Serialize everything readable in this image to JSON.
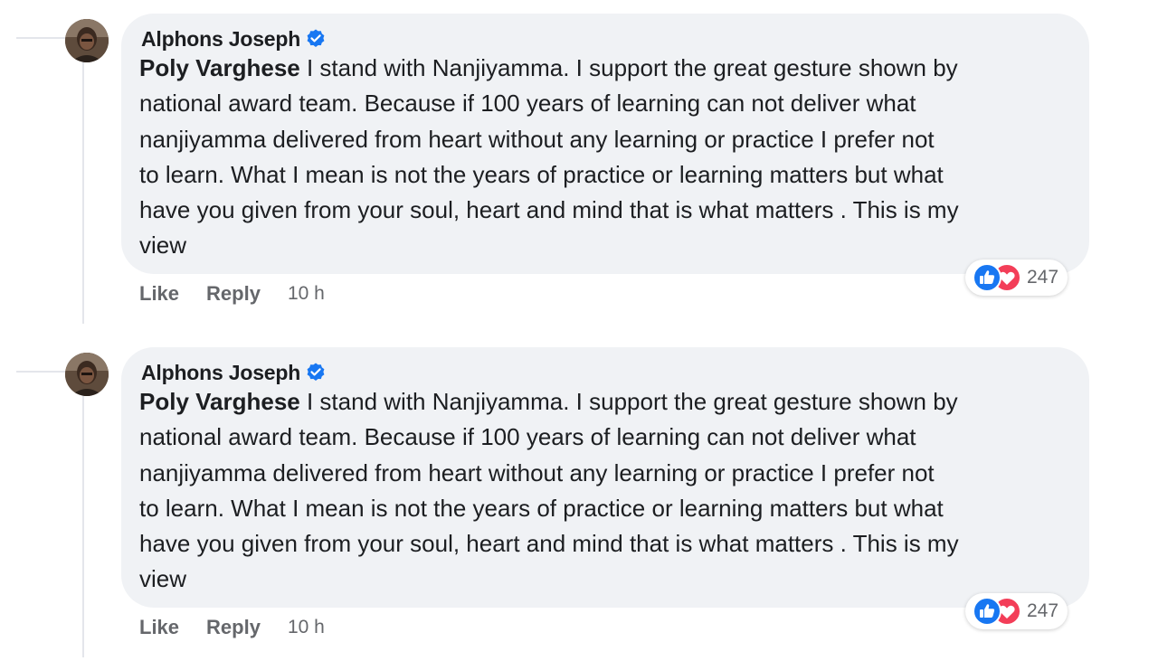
{
  "comments": [
    {
      "author": "Alphons Joseph",
      "mention": "Poly Varghese",
      "text_lines": [
        " I stand with Nanjiyamma. I support the great gesture shown by",
        "national award team. Because if 100 years of learning can not deliver what",
        "nanjiyamma delivered from heart without any learning or practice I prefer not",
        "to learn. What I mean is not the years of practice or learning matters but what",
        "have you given from your soul, heart and mind that is what matters . This is my",
        "view"
      ],
      "like_label": "Like",
      "reply_label": "Reply",
      "time": "10 h",
      "reaction_count": "247",
      "reaction_icons": [
        "like-icon",
        "love-icon"
      ]
    },
    {
      "author": "Alphons Joseph",
      "mention": "Poly Varghese",
      "text_lines": [
        " I stand with Nanjiyamma. I support the great gesture shown by",
        "national award team. Because if 100 years of learning can not deliver what",
        "nanjiyamma delivered from heart without any learning or practice I prefer not",
        "to learn. What I mean is not the years of practice or learning matters but what",
        "have you given from your soul, heart and mind that is what matters . This is my",
        "view"
      ],
      "like_label": "Like",
      "reply_label": "Reply",
      "time": "10 h",
      "reaction_count": "247",
      "reaction_icons": [
        "like-icon",
        "love-icon"
      ]
    }
  ],
  "colors": {
    "verified": "#1877f2",
    "like": "#1877f2",
    "love": "#f33e58",
    "bubble": "#f0f2f5",
    "muted_text": "#65676b"
  }
}
